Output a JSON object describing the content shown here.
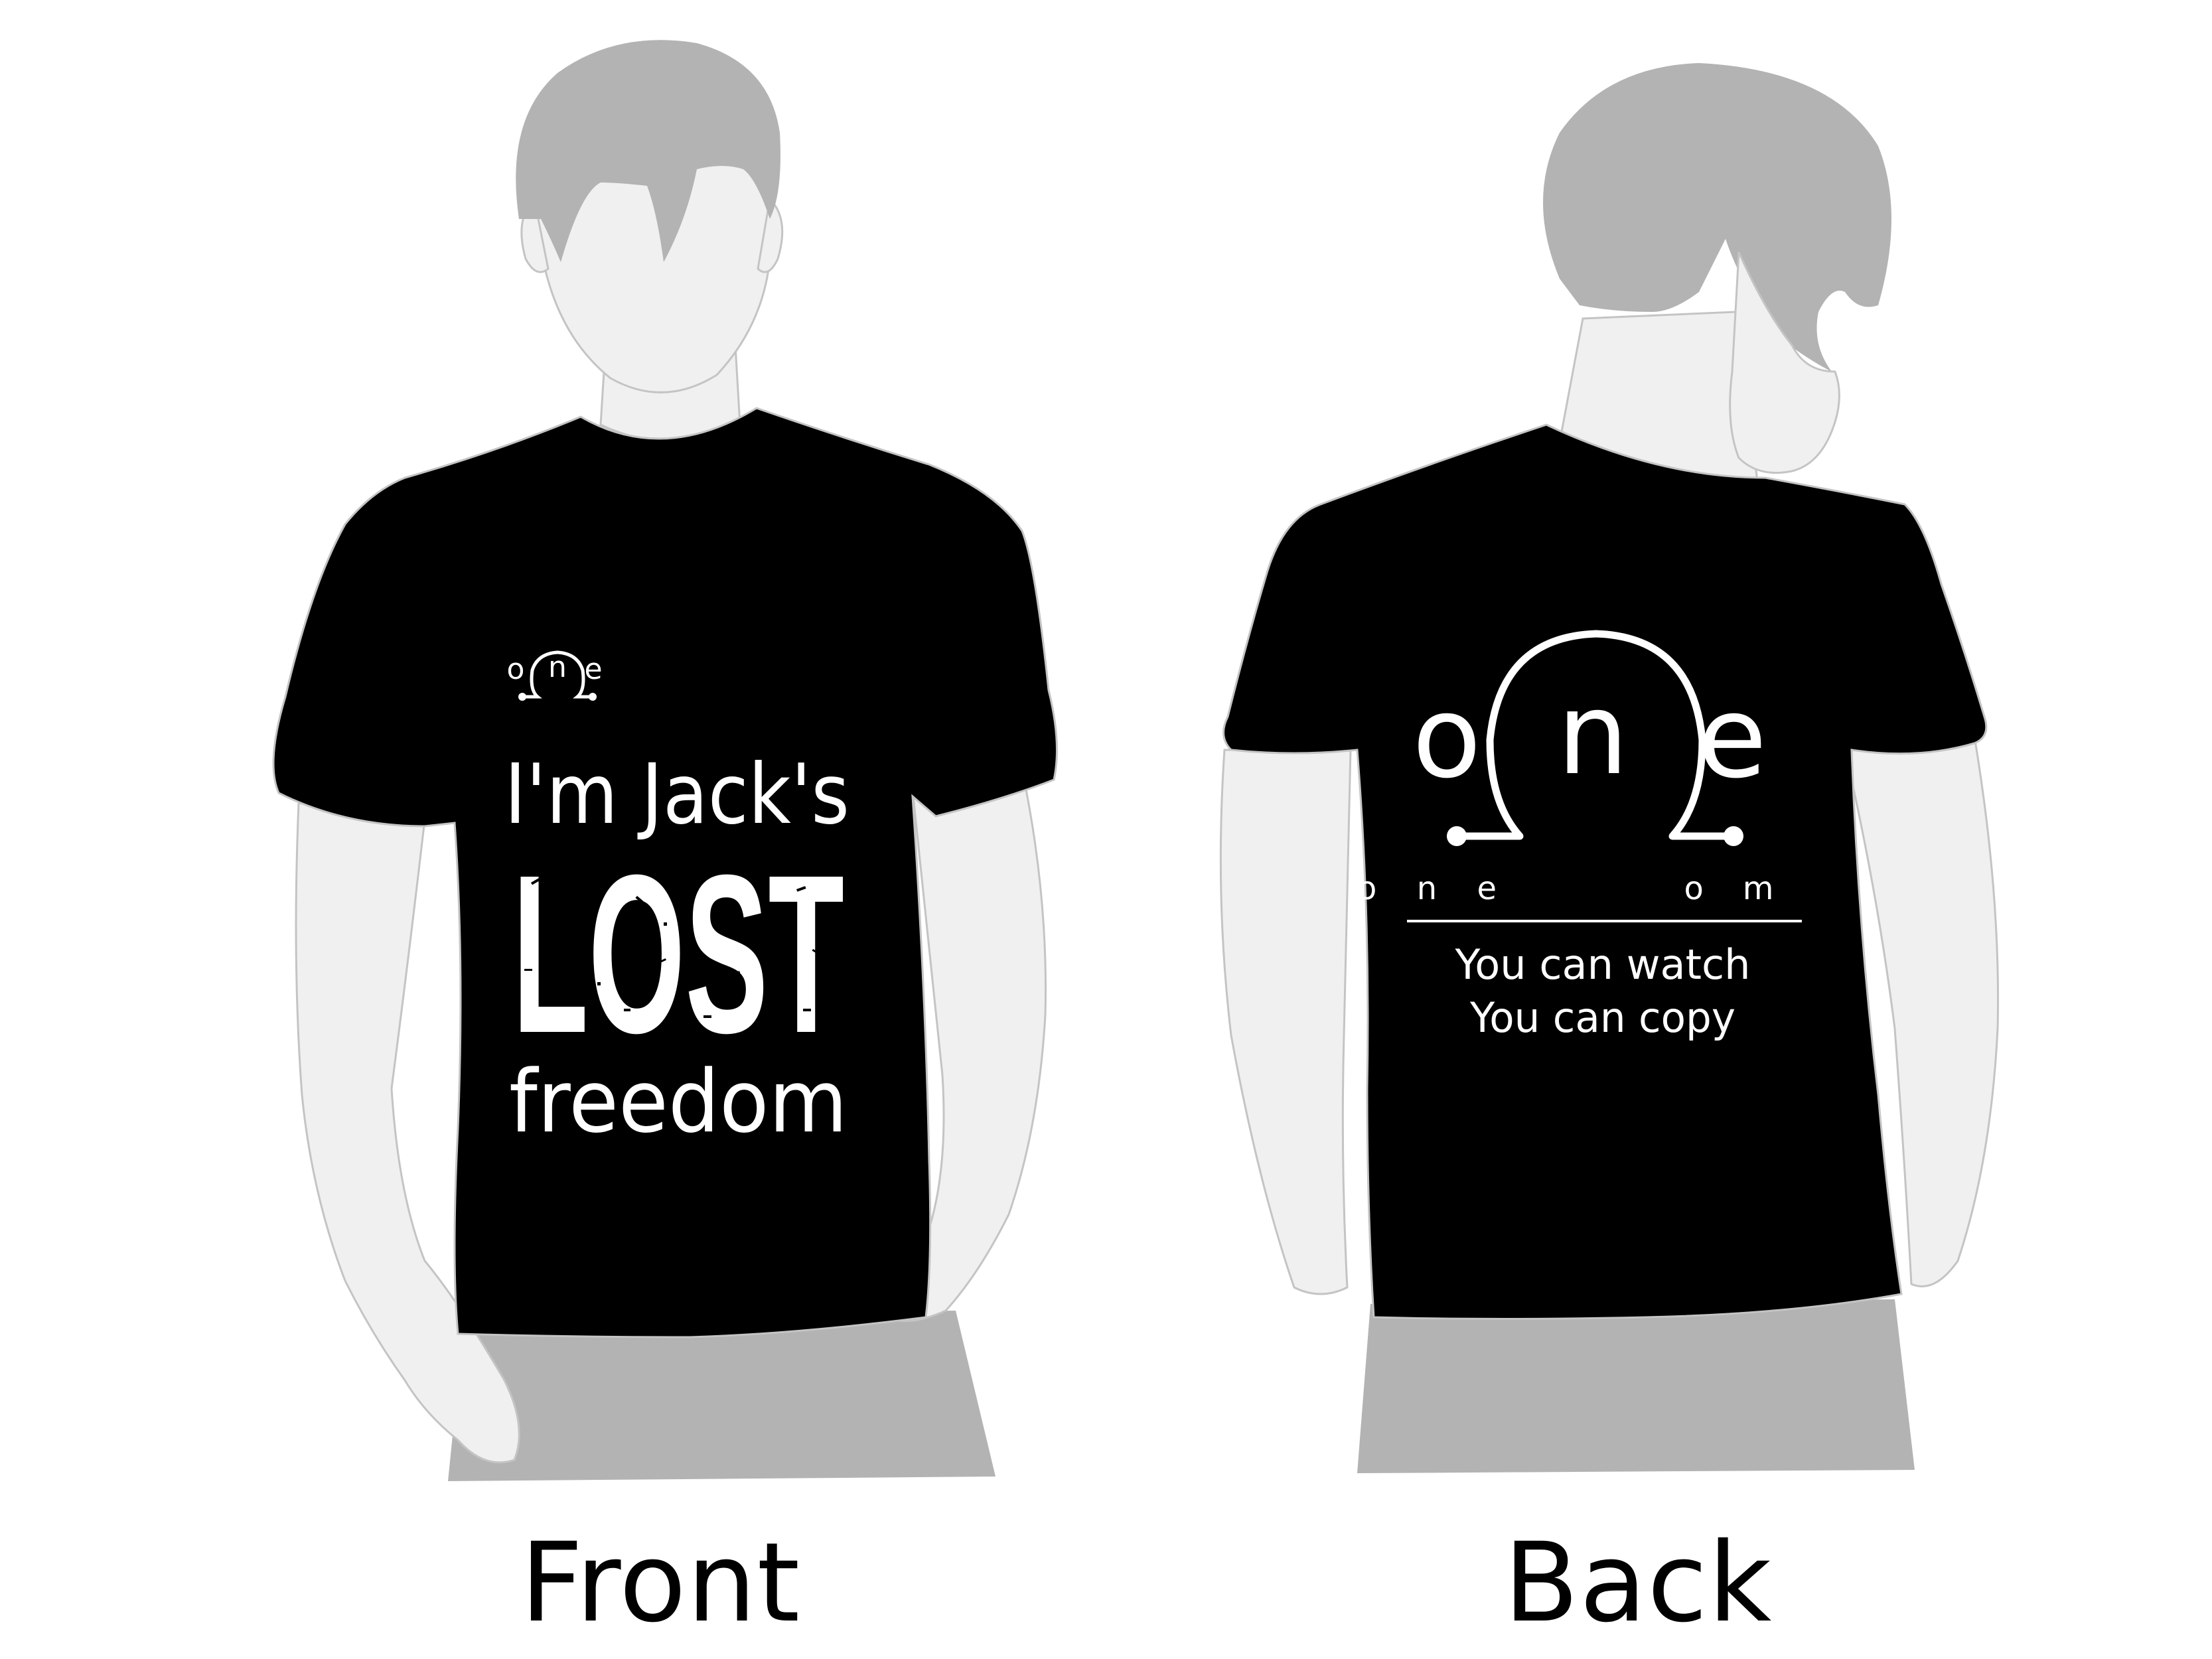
{
  "colors": {
    "background": "#ffffff",
    "skin": "#f0f0f0",
    "skin_outline": "#c4c4c4",
    "hair": "#b3b3b3",
    "pants": "#b3b3b3",
    "shirt": "#000000",
    "print": "#ffffff",
    "caption": "#000000"
  },
  "front": {
    "caption": "Front",
    "small_logo": {
      "left": "o",
      "middle": "n",
      "right": "e"
    },
    "line1": "I'm Jack's",
    "line2": "LOST",
    "line3": "freedom"
  },
  "back": {
    "caption": "Back",
    "logo": {
      "left": "o",
      "middle": "n",
      "right": "e"
    },
    "tagline": {
      "one": "o n e",
      "om": "o m"
    },
    "line1": "You can watch",
    "line2": "You can copy"
  }
}
